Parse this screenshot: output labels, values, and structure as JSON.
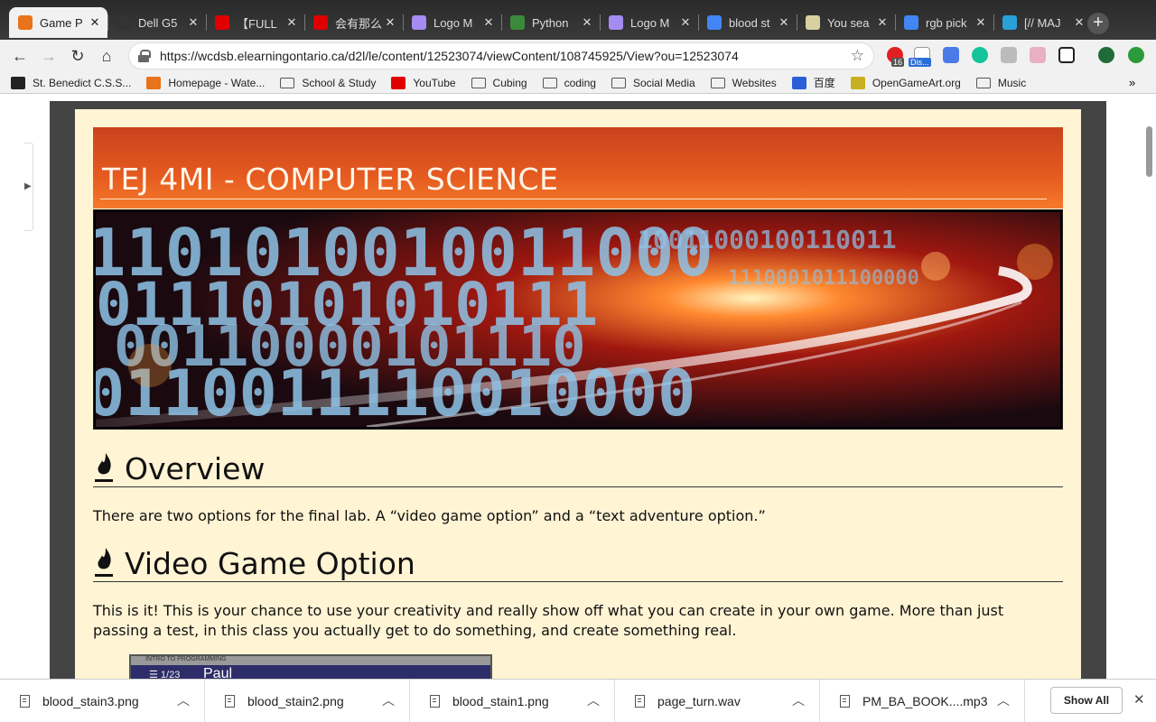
{
  "tabs": [
    {
      "title": "Game P",
      "active": true,
      "favicon_color": "#e8731a",
      "icon": "d2l-icon"
    },
    {
      "title": "Dell G5",
      "active": false,
      "favicon_color": "#333333",
      "icon": "dell-icon"
    },
    {
      "title": "【FULL",
      "active": false,
      "favicon_color": "#e00000",
      "icon": "youtube-icon"
    },
    {
      "title": "会有那么",
      "active": false,
      "favicon_color": "#e00000",
      "icon": "youtube-icon"
    },
    {
      "title": "Logo M",
      "active": false,
      "favicon_color": "#a48cf0",
      "icon": "logo-maker-icon"
    },
    {
      "title": "Python",
      "active": false,
      "favicon_color": "#3b8a3b",
      "icon": "python-icon"
    },
    {
      "title": "Logo M",
      "active": false,
      "favicon_color": "#a48cf0",
      "icon": "logo-maker-icon"
    },
    {
      "title": "blood st",
      "active": false,
      "favicon_color": "#4285f4",
      "icon": "google-icon"
    },
    {
      "title": "You sea",
      "active": false,
      "favicon_color": "#d8d0a0",
      "icon": "zap-icon"
    },
    {
      "title": "rgb pick",
      "active": false,
      "favicon_color": "#4285f4",
      "icon": "google-icon"
    },
    {
      "title": "[// MAJ",
      "active": false,
      "favicon_color": "#2aa0d8",
      "icon": "plus-square-icon"
    }
  ],
  "toolbar": {
    "url": "https://wcdsb.elearningontario.ca/d2l/le/content/12523074/viewContent/108745925/View?ou=12523074",
    "ext_badge_count": "16",
    "ext_badge_text": "Dis..."
  },
  "bookmarks": [
    {
      "label": "St. Benedict C.S.S...",
      "kind": "site",
      "color": "#222222"
    },
    {
      "label": "Homepage - Wate...",
      "kind": "site",
      "color": "#e8731a"
    },
    {
      "label": "School & Study",
      "kind": "folder"
    },
    {
      "label": "YouTube",
      "kind": "site",
      "color": "#e00000"
    },
    {
      "label": "Cubing",
      "kind": "folder"
    },
    {
      "label": "coding",
      "kind": "folder"
    },
    {
      "label": "Social Media",
      "kind": "folder"
    },
    {
      "label": "Websites",
      "kind": "folder"
    },
    {
      "label": "百度",
      "kind": "site",
      "color": "#2a5fd8"
    },
    {
      "label": "OpenGameArt.org",
      "kind": "site",
      "color": "#c8b020"
    },
    {
      "label": "Music",
      "kind": "folder"
    }
  ],
  "page": {
    "banner_title": "TEJ 4MI - COMPUTER SCIENCE",
    "section1_title": "Overview",
    "section1_text": "There are two options for the final lab. A “video game option” and a “text adventure option.”",
    "section2_title": "Video Game Option",
    "section2_text": "This is it! This is your chance to use your creativity and really show off what you can create in your own game. More than just passing a test, in this class you actually get to do something, and create something real.",
    "screenshot_bar": "INTRO TO PROGRAMMING",
    "screenshot_counter": "1/23",
    "screenshot_name": "Paul"
  },
  "downloads": [
    {
      "file": "blood_stain3.png"
    },
    {
      "file": "blood_stain2.png"
    },
    {
      "file": "blood_stain1.png"
    },
    {
      "file": "page_turn.wav"
    },
    {
      "file": "PM_BA_BOOK....mp3"
    }
  ],
  "download_bar": {
    "show_all": "Show All"
  },
  "colors": {
    "banner": "#e55a20",
    "paper": "#fff4d4",
    "frame": "#444444"
  }
}
